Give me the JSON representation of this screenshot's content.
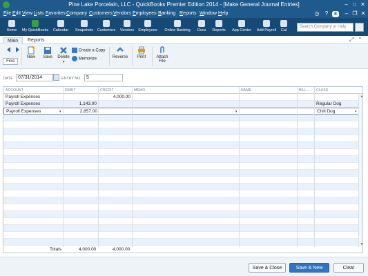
{
  "window": {
    "title": "Pine Lake Porcelain, LLC  - QuickBooks Premier Edition 2014 - [Make General Journal Entries]",
    "badge_count": "8"
  },
  "menu": [
    "File",
    "Edit",
    "View",
    "Lists",
    "Favorites",
    "Company",
    "Customers",
    "Vendors",
    "Employees",
    "Banking",
    "Reports",
    "Window",
    "Help"
  ],
  "iconbar": {
    "items": [
      "Home",
      "My QuickBooks",
      "Calendar",
      "Snapshots",
      "Customers",
      "Vendors",
      "Employees",
      "Online Banking",
      "Docs",
      "Reports",
      "App Center",
      "Add Payroll",
      "Cal"
    ],
    "search_placeholder": "Search Company or Help"
  },
  "tabs": [
    "Main",
    "Reports"
  ],
  "ribbon": {
    "find": "Find",
    "new": "New",
    "save": "Save",
    "delete": "Delete",
    "create_copy": "Create a Copy",
    "memorize": "Memorize",
    "reverse": "Reverse",
    "print": "Print",
    "attach": "Attach",
    "attach2": "File"
  },
  "form": {
    "date_label": "DATE",
    "date_value": "07/31/2014",
    "entry_label": "ENTRY NO.",
    "entry_value": "5"
  },
  "grid": {
    "columns": [
      "ACCOUNT",
      "DEBIT",
      "CREDIT",
      "MEMO",
      "NAME",
      "BILL...",
      "CLASS"
    ],
    "rows": [
      {
        "account": "Payroll Expenses",
        "debit": "",
        "credit": "4,000.00",
        "memo": "",
        "name": "",
        "bill": "",
        "class": ""
      },
      {
        "account": "Payroll Expenses",
        "debit": "1,143.00",
        "credit": "",
        "memo": "",
        "name": "",
        "bill": "",
        "class": "Regular Dog"
      },
      {
        "account": "Payroll Expenses",
        "debit": "2,857.00",
        "credit": "",
        "memo": "",
        "name": "",
        "bill": "",
        "class": "Chili Dog"
      }
    ]
  },
  "totals": {
    "label": "Totals",
    "debit": "4,000.00",
    "credit": "4,000.00"
  },
  "footer": {
    "save_close": "Save & Close",
    "save_new": "Save & New",
    "clear": "Clear"
  }
}
